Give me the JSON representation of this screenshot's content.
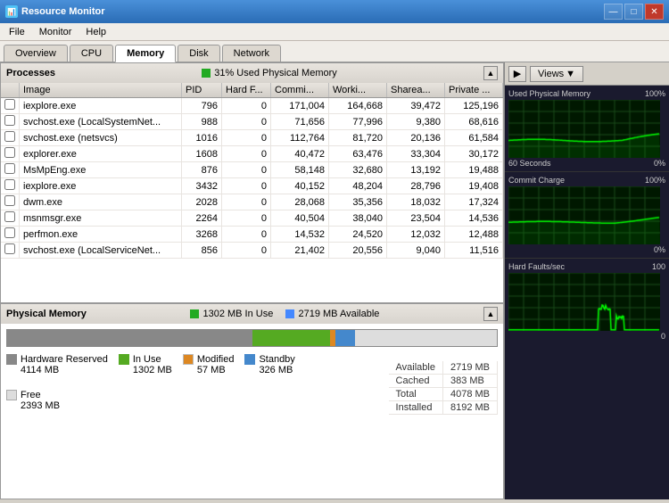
{
  "titlebar": {
    "title": "Resource Monitor",
    "icon": "📊",
    "buttons": {
      "minimize": "—",
      "maximize": "□",
      "close": "✕"
    }
  },
  "menubar": {
    "items": [
      "File",
      "Monitor",
      "Help"
    ]
  },
  "tabs": {
    "items": [
      "Overview",
      "CPU",
      "Memory",
      "Disk",
      "Network"
    ],
    "active": "Memory"
  },
  "processes": {
    "title": "Processes",
    "status": "31% Used Physical Memory",
    "columns": [
      "Image",
      "PID",
      "Hard F...",
      "Commi...",
      "Worki...",
      "Sharea...",
      "Private ..."
    ],
    "rows": [
      {
        "image": "iexplore.exe",
        "pid": "796",
        "hard": "0",
        "commit": "171,004",
        "working": "164,668",
        "shared": "39,472",
        "private": "125,196"
      },
      {
        "image": "svchost.exe (LocalSystemNet...",
        "pid": "988",
        "hard": "0",
        "commit": "71,656",
        "working": "77,996",
        "shared": "9,380",
        "private": "68,616"
      },
      {
        "image": "svchost.exe (netsvcs)",
        "pid": "1016",
        "hard": "0",
        "commit": "112,764",
        "working": "81,720",
        "shared": "20,136",
        "private": "61,584"
      },
      {
        "image": "explorer.exe",
        "pid": "1608",
        "hard": "0",
        "commit": "40,472",
        "working": "63,476",
        "shared": "33,304",
        "private": "30,172"
      },
      {
        "image": "MsMpEng.exe",
        "pid": "876",
        "hard": "0",
        "commit": "58,148",
        "working": "32,680",
        "shared": "13,192",
        "private": "19,488"
      },
      {
        "image": "iexplore.exe",
        "pid": "3432",
        "hard": "0",
        "commit": "40,152",
        "working": "48,204",
        "shared": "28,796",
        "private": "19,408"
      },
      {
        "image": "dwm.exe",
        "pid": "2028",
        "hard": "0",
        "commit": "28,068",
        "working": "35,356",
        "shared": "18,032",
        "private": "17,324"
      },
      {
        "image": "msnmsgr.exe",
        "pid": "2264",
        "hard": "0",
        "commit": "40,504",
        "working": "38,040",
        "shared": "23,504",
        "private": "14,536"
      },
      {
        "image": "perfmon.exe",
        "pid": "3268",
        "hard": "0",
        "commit": "14,532",
        "working": "24,520",
        "shared": "12,032",
        "private": "12,488"
      },
      {
        "image": "svchost.exe (LocalServiceNet...",
        "pid": "856",
        "hard": "0",
        "commit": "21,402",
        "working": "20,556",
        "shared": "9,040",
        "private": "11,516"
      }
    ]
  },
  "physical_memory": {
    "title": "Physical Memory",
    "in_use_label": "1302 MB In Use",
    "available_label": "2719 MB Available",
    "bar": {
      "hardware_pct": 50,
      "in_use_pct": 16,
      "modified_pct": 1,
      "standby_pct": 4,
      "free_pct": 29
    },
    "legend": {
      "hardware": {
        "label": "Hardware Reserved",
        "value": "4114 MB",
        "color": "#888888"
      },
      "in_use": {
        "label": "In Use",
        "value": "1302 MB",
        "color": "#55aa22"
      },
      "modified": {
        "label": "Modified",
        "value": "57 MB",
        "color": "#dd8822"
      },
      "standby": {
        "label": "Standby",
        "value": "326 MB",
        "color": "#4488cc"
      },
      "free": {
        "label": "Free",
        "value": "2393 MB",
        "color": "#dddddd"
      }
    },
    "stats": {
      "available": {
        "label": "Available",
        "value": "2719 MB"
      },
      "cached": {
        "label": "Cached",
        "value": "383 MB"
      },
      "total": {
        "label": "Total",
        "value": "4078 MB"
      },
      "installed": {
        "label": "Installed",
        "value": "8192 MB"
      }
    }
  },
  "right_panel": {
    "views_label": "Views",
    "graphs": [
      {
        "title": "Used Physical Memory",
        "max_label": "100%",
        "min_label": "0%",
        "subtitle": "60 Seconds"
      },
      {
        "title": "Commit Charge",
        "max_label": "100%",
        "min_label": "0%"
      },
      {
        "title": "Hard Faults/sec",
        "max_label": "100",
        "min_label": "0"
      }
    ]
  }
}
